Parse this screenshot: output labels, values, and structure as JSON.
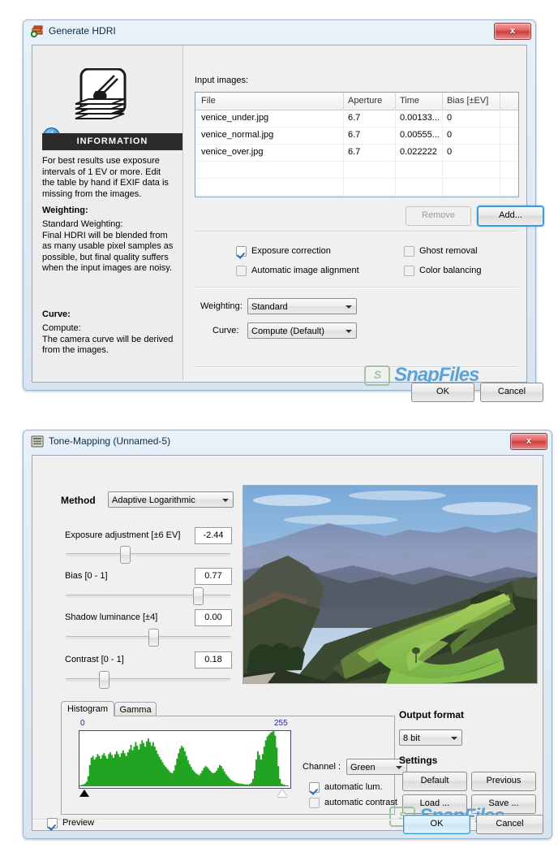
{
  "dialog1": {
    "title": "Generate HDRI",
    "icon": "layers-add-icon",
    "close_label": "x",
    "input_images_label": "Input images:",
    "info": {
      "icon": "brush-layers-icon",
      "badge": "i",
      "header": "INFORMATION",
      "body1": "For best results use exposure intervals of 1 EV or more. Edit the table by hand if EXIF data is missing from the images.",
      "heading1": "Weighting:",
      "body2": "Standard Weighting:\nFinal HDRI will be blended from as many usable pixel samples as possible, but final quality suffers when the input images are noisy.",
      "heading2": "Curve:",
      "body3": "Compute:\nThe camera curve will be derived from the images."
    },
    "table": {
      "columns": [
        "File",
        "Aperture",
        "Time",
        "Bias [±EV]",
        ""
      ],
      "rows": [
        [
          "venice_under.jpg",
          "6.7",
          "0.00133...",
          "0",
          ""
        ],
        [
          "venice_normal.jpg",
          "6.7",
          "0.00555...",
          "0",
          ""
        ],
        [
          "venice_over.jpg",
          "6.7",
          "0.022222",
          "0",
          ""
        ]
      ]
    },
    "remove_label": "Remove",
    "add_label": "Add...",
    "checkboxes": [
      {
        "label": "Exposure correction",
        "checked": true
      },
      {
        "label": "Automatic image alignment",
        "checked": false
      },
      {
        "label": "Ghost removal",
        "checked": false
      },
      {
        "label": "Color balancing",
        "checked": false
      }
    ],
    "weighting_label": "Weighting:",
    "weighting_value": "Standard",
    "curve_label": "Curve:",
    "curve_value": "Compute  (Default)",
    "ok_label": "OK",
    "cancel_label": "Cancel",
    "watermark": "SnapFiles"
  },
  "dialog2": {
    "title": "Tone-Mapping (Unnamed-5)",
    "icon": "tonemap-icon",
    "close_label": "x",
    "method_label": "Method",
    "method_value": "Adaptive Logarithmic",
    "sliders": [
      {
        "label": "Exposure adjustment [±6 EV]",
        "value": "-2.44",
        "pos": 33
      },
      {
        "label": "Bias [0 - 1]",
        "value": "0.77",
        "pos": 77
      },
      {
        "label": "Shadow luminance [±4]",
        "value": "0.00",
        "pos": 50
      },
      {
        "label": "Contrast [0 - 1]",
        "value": "0.18",
        "pos": 18
      }
    ],
    "preview_image_alt": "mountain-landscape-preview",
    "tabs": [
      {
        "label": "Histogram",
        "selected": true
      },
      {
        "label": "Gamma",
        "selected": false
      }
    ],
    "histogram": {
      "min_label": "0",
      "max_label": "255",
      "color": "#22a322"
    },
    "channel_label": "Channel :",
    "channel_value": "Green",
    "histogram_checkboxes": [
      {
        "label": "automatic lum.",
        "checked": true
      },
      {
        "label": "automatic contrast",
        "checked": false
      }
    ],
    "output_format_heading": "Output format",
    "output_format_value": "8 bit",
    "settings_heading": "Settings",
    "settings_buttons": [
      "Default",
      "Previous",
      "Load ...",
      "Save ..."
    ],
    "preview_checkbox": {
      "label": "Preview",
      "checked": true
    },
    "ok_label": "OK",
    "cancel_label": "Cancel",
    "watermark": "SnapFiles"
  },
  "chart_data": {
    "type": "bar",
    "title": "Histogram",
    "xlabel": "",
    "ylabel": "",
    "xlim": [
      0,
      255
    ],
    "categories": [
      "0",
      "255"
    ],
    "values": [
      2,
      3,
      4,
      6,
      10,
      22,
      46,
      62,
      66,
      58,
      63,
      70,
      66,
      60,
      68,
      72,
      66,
      60,
      70,
      74,
      68,
      62,
      70,
      76,
      70,
      64,
      72,
      78,
      72,
      66,
      74,
      80,
      90,
      78,
      86,
      96,
      88,
      80,
      92,
      100,
      94,
      86,
      98,
      104,
      96,
      88,
      96,
      86,
      78,
      70,
      64,
      58,
      52,
      46,
      42,
      38,
      34,
      30,
      28,
      34,
      46,
      60,
      72,
      82,
      88,
      84,
      76,
      66,
      56,
      48,
      42,
      36,
      32,
      28,
      26,
      24,
      28,
      34,
      40,
      44,
      42,
      38,
      34,
      30,
      28,
      30,
      34,
      40,
      46,
      44,
      38,
      32,
      26,
      22,
      18,
      14,
      12,
      10,
      8,
      7,
      6,
      6,
      5,
      5,
      4,
      4,
      4,
      5,
      8,
      16,
      34,
      58,
      76,
      68,
      58,
      70,
      86,
      100,
      108,
      112,
      116,
      118,
      120,
      110,
      84,
      44,
      16,
      6,
      4,
      3,
      2,
      2
    ]
  }
}
